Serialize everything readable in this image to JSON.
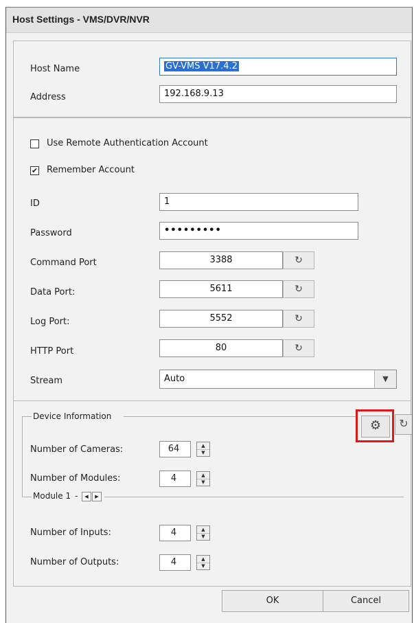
{
  "window": {
    "title": "Host Settings - VMS/DVR/NVR"
  },
  "host": {
    "name_label": "Host Name",
    "name_value": "GV-VMS V17.4.2",
    "address_label": "Address",
    "address_value": "192.168.9.13"
  },
  "auth": {
    "use_remote_label": "Use Remote Authentication Account",
    "use_remote_checked": false,
    "remember_label": "Remember Account",
    "remember_checked": true,
    "id_label": "ID",
    "id_value": "1",
    "password_label": "Password",
    "password_value": "•••••••••",
    "ports": [
      {
        "label": "Command Port",
        "value": "3388"
      },
      {
        "label": "Data Port:",
        "value": "5611"
      },
      {
        "label": "Log Port:",
        "value": "5552"
      },
      {
        "label": "HTTP Port",
        "value": "80"
      }
    ],
    "stream_label": "Stream",
    "stream_value": "Auto"
  },
  "device": {
    "group_title": "Device Information",
    "cameras_label": "Number of Cameras:",
    "cameras_value": "64",
    "modules_label": "Number of Modules:",
    "modules_value": "4",
    "module_title": "Module 1",
    "inputs_label": "Number of Inputs:",
    "inputs_value": "4",
    "outputs_label": "Number of Outputs:",
    "outputs_value": "4"
  },
  "buttons": {
    "ok": "OK",
    "cancel": "Cancel"
  },
  "icons": {
    "reset": "reset-icon",
    "settings": "gear-icon",
    "refresh": "refresh-icon",
    "dropdown": "chevron-down-icon"
  },
  "colors": {
    "highlight_box": "#e01818",
    "selection": "#2a6fd6"
  }
}
